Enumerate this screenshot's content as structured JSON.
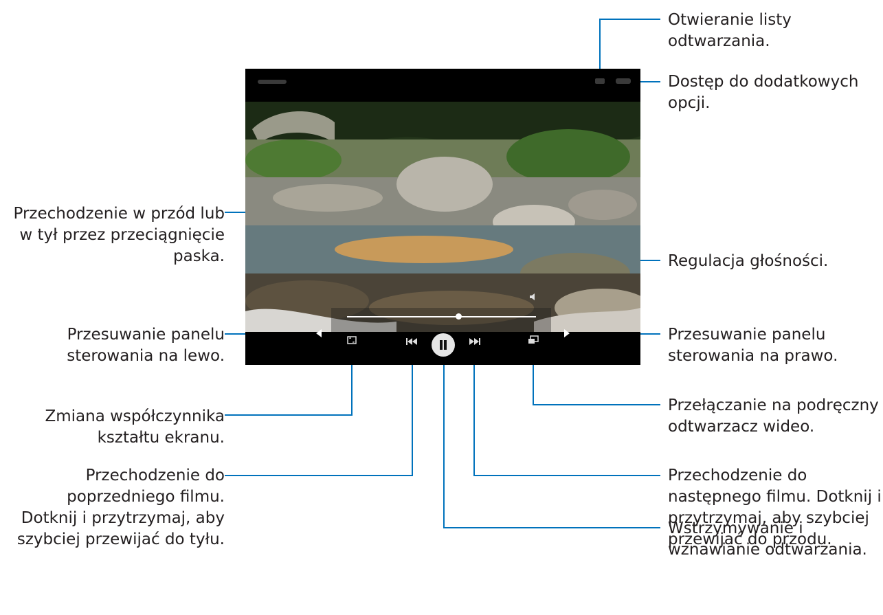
{
  "colors": {
    "leader_line": "#0072bc",
    "text": "#231f20",
    "screen_bg": "#000000"
  },
  "annotations": {
    "playlist": [
      "Otwieranie listy",
      "odtwarzania."
    ],
    "more_options": [
      "Dostęp do dodatkowych",
      "opcji."
    ],
    "seek": [
      "Przechodzenie w przód lub",
      "w tył przez przeciągnięcie",
      "paska."
    ],
    "volume": [
      "Regulacja głośności."
    ],
    "move_left": [
      "Przesuwanie panelu",
      "sterowania na lewo."
    ],
    "move_right": [
      "Przesuwanie panelu",
      "sterowania na prawo."
    ],
    "aspect_ratio": [
      "Zmiana współczynnika",
      "kształtu ekranu."
    ],
    "popup": [
      "Przełączanie na podręczny",
      "odtwarzacz wideo."
    ],
    "previous": [
      "Przechodzenie do",
      "poprzedniego filmu.",
      "Dotknij i przytrzymaj, aby",
      "szybciej przewijać do tyłu."
    ],
    "next": [
      "Przechodzenie do",
      "następnego filmu. Dotknij i",
      "przytrzymaj, aby szybciej",
      "przewijać do przodu."
    ],
    "pause": [
      "Wstrzymywanie i",
      "wznawianie odtwarzania."
    ]
  },
  "icons": {
    "playlist": "playlist-icon",
    "more": "more-options-icon",
    "volume": "volume-icon",
    "ratio": "aspect-ratio-icon",
    "prev": "previous-track-icon",
    "pause": "pause-icon",
    "next": "next-track-icon",
    "popup": "popup-player-icon",
    "left": "move-left-arrow-icon",
    "right": "move-right-arrow-icon"
  }
}
